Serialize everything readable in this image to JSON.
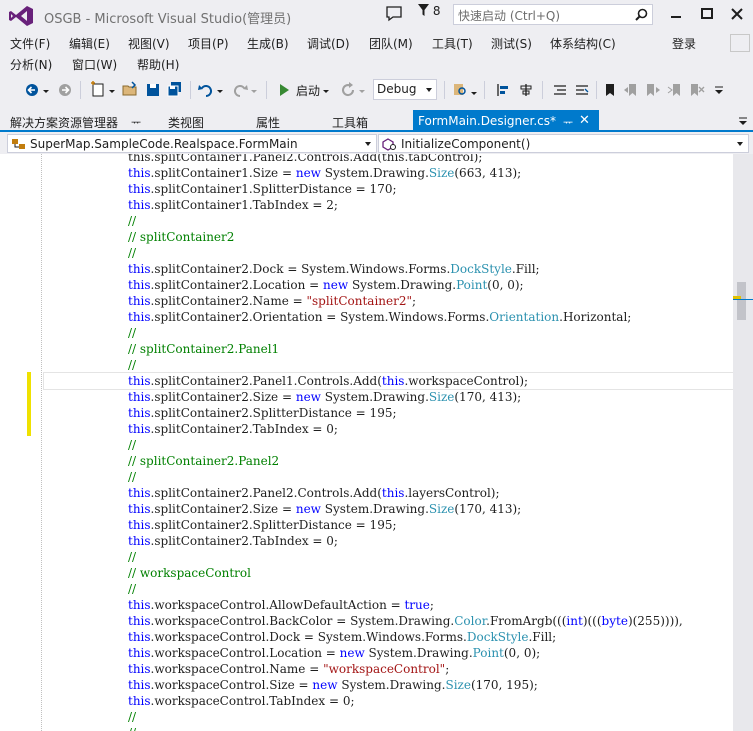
{
  "window": {
    "title": "OSGB - Microsoft Visual Studio(管理员)",
    "notification_count": "8",
    "quick_launch_placeholder": "快速启动 (Ctrl+Q)"
  },
  "menu": {
    "row1": [
      "文件(F)",
      "编辑(E)",
      "视图(V)",
      "项目(P)",
      "生成(B)",
      "调试(D)",
      "团队(M)",
      "工具(T)",
      "测试(S)",
      "体系结构(C)"
    ],
    "row2": [
      "分析(N)",
      "窗口(W)",
      "帮助(H)"
    ],
    "login": "登录"
  },
  "toolbar": {
    "start_label": "启动",
    "config": "Debug"
  },
  "tabs": {
    "panels": [
      "解决方案资源管理器",
      "类视图",
      "属性",
      "工具箱"
    ],
    "pin": "ᅲ",
    "document": "FormMain.Designer.cs*"
  },
  "navbar": {
    "class": "SuperMap.SampleCode.Realspace.FormMain",
    "member": "InitializeComponent()"
  },
  "code": {
    "lines": [
      [
        [
          "",
          "this.splitContainer1.Panel2.Controls.Add(this.tabControl);"
        ]
      ],
      [
        [
          "kw",
          "this"
        ],
        [
          "",
          ".splitContainer1.Size = "
        ],
        [
          "kw",
          "new"
        ],
        [
          "",
          " System.Drawing."
        ],
        [
          "ty",
          "Size"
        ],
        [
          "",
          "(663, 413);"
        ]
      ],
      [
        [
          "kw",
          "this"
        ],
        [
          "",
          ".splitContainer1.SplitterDistance = 170;"
        ]
      ],
      [
        [
          "kw",
          "this"
        ],
        [
          "",
          ".splitContainer1.TabIndex = 2;"
        ]
      ],
      [
        [
          "cm",
          "//"
        ]
      ],
      [
        [
          "cm",
          "// splitContainer2"
        ]
      ],
      [
        [
          "cm",
          "//"
        ]
      ],
      [
        [
          "kw",
          "this"
        ],
        [
          "",
          ".splitContainer2.Dock = System.Windows.Forms."
        ],
        [
          "ty",
          "DockStyle"
        ],
        [
          "",
          ".Fill;"
        ]
      ],
      [
        [
          "kw",
          "this"
        ],
        [
          "",
          ".splitContainer2.Location = "
        ],
        [
          "kw",
          "new"
        ],
        [
          "",
          " System.Drawing."
        ],
        [
          "ty",
          "Point"
        ],
        [
          "",
          "(0, 0);"
        ]
      ],
      [
        [
          "kw",
          "this"
        ],
        [
          "",
          ".splitContainer2.Name = "
        ],
        [
          "str",
          "\"splitContainer2\""
        ],
        [
          "",
          ";"
        ]
      ],
      [
        [
          "kw",
          "this"
        ],
        [
          "",
          ".splitContainer2.Orientation = System.Windows.Forms."
        ],
        [
          "ty",
          "Orientation"
        ],
        [
          "",
          ".Horizontal;"
        ]
      ],
      [
        [
          "cm",
          "//"
        ]
      ],
      [
        [
          "cm",
          "// splitContainer2.Panel1"
        ]
      ],
      [
        [
          "cm",
          "//"
        ]
      ],
      [
        [
          "kw",
          "this"
        ],
        [
          "",
          ".splitContainer2.Panel1.Controls.Add("
        ],
        [
          "kw",
          "this"
        ],
        [
          "",
          ".workspaceControl);"
        ]
      ],
      [
        [
          "kw",
          "this"
        ],
        [
          "",
          ".splitContainer2.Size = "
        ],
        [
          "kw",
          "new"
        ],
        [
          "",
          " System.Drawing."
        ],
        [
          "ty",
          "Size"
        ],
        [
          "",
          "(170, 413);"
        ]
      ],
      [
        [
          "kw",
          "this"
        ],
        [
          "",
          ".splitContainer2.SplitterDistance = 195;"
        ]
      ],
      [
        [
          "kw",
          "this"
        ],
        [
          "",
          ".splitContainer2.TabIndex = 0;"
        ]
      ],
      [
        [
          "cm",
          "//"
        ]
      ],
      [
        [
          "cm",
          "// splitContainer2.Panel2"
        ]
      ],
      [
        [
          "cm",
          "//"
        ]
      ],
      [
        [
          "kw",
          "this"
        ],
        [
          "",
          ".splitContainer2.Panel2.Controls.Add("
        ],
        [
          "kw",
          "this"
        ],
        [
          "",
          ".layersControl);"
        ]
      ],
      [
        [
          "kw",
          "this"
        ],
        [
          "",
          ".splitContainer2.Size = "
        ],
        [
          "kw",
          "new"
        ],
        [
          "",
          " System.Drawing."
        ],
        [
          "ty",
          "Size"
        ],
        [
          "",
          "(170, 413);"
        ]
      ],
      [
        [
          "kw",
          "this"
        ],
        [
          "",
          ".splitContainer2.SplitterDistance = 195;"
        ]
      ],
      [
        [
          "kw",
          "this"
        ],
        [
          "",
          ".splitContainer2.TabIndex = 0;"
        ]
      ],
      [
        [
          "cm",
          "//"
        ]
      ],
      [
        [
          "cm",
          "// workspaceControl"
        ]
      ],
      [
        [
          "cm",
          "//"
        ]
      ],
      [
        [
          "kw",
          "this"
        ],
        [
          "",
          ".workspaceControl.AllowDefaultAction = "
        ],
        [
          "kw",
          "true"
        ],
        [
          "",
          ";"
        ]
      ],
      [
        [
          "kw",
          "this"
        ],
        [
          "",
          ".workspaceControl.BackColor = System.Drawing."
        ],
        [
          "ty",
          "Color"
        ],
        [
          "",
          ".FromArgb((("
        ],
        [
          "kw",
          "int"
        ],
        [
          "",
          ")((("
        ],
        [
          "kw",
          "byte"
        ],
        [
          "",
          ")(255)))),"
        ]
      ],
      [
        [
          "kw",
          "this"
        ],
        [
          "",
          ".workspaceControl.Dock = System.Windows.Forms."
        ],
        [
          "ty",
          "DockStyle"
        ],
        [
          "",
          ".Fill;"
        ]
      ],
      [
        [
          "kw",
          "this"
        ],
        [
          "",
          ".workspaceControl.Location = "
        ],
        [
          "kw",
          "new"
        ],
        [
          "",
          " System.Drawing."
        ],
        [
          "ty",
          "Point"
        ],
        [
          "",
          "(0, 0);"
        ]
      ],
      [
        [
          "kw",
          "this"
        ],
        [
          "",
          ".workspaceControl.Name = "
        ],
        [
          "str",
          "\"workspaceControl\""
        ],
        [
          "",
          ";"
        ]
      ],
      [
        [
          "kw",
          "this"
        ],
        [
          "",
          ".workspaceControl.Size = "
        ],
        [
          "kw",
          "new"
        ],
        [
          "",
          " System.Drawing."
        ],
        [
          "ty",
          "Size"
        ],
        [
          "",
          "(170, 195);"
        ]
      ],
      [
        [
          "kw",
          "this"
        ],
        [
          "",
          ".workspaceControl.TabIndex = 0;"
        ]
      ],
      [
        [
          "cm",
          "//"
        ]
      ],
      [
        [
          "cm",
          "//"
        ]
      ]
    ],
    "current_line": 14
  },
  "colors": {
    "accent": "#007acc",
    "keyword": "#0000ff",
    "type": "#2b91af",
    "string": "#a31515",
    "comment": "#008000",
    "change_marker": "#efe100"
  }
}
